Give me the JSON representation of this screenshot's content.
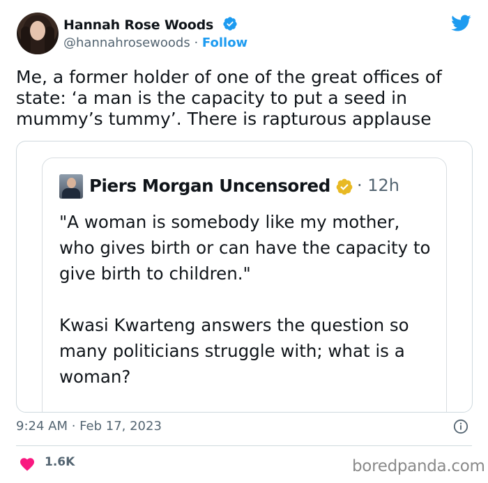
{
  "author": {
    "name": "Hannah Rose Woods",
    "handle": "@hannahrosewoods",
    "separator": "·",
    "follow_label": "Follow"
  },
  "tweet": {
    "text": "Me, a former holder of one of the great offices of state: ‘a man is the capacity to put a seed in mummy’s tummy’. There is rapturous applause"
  },
  "quoted": {
    "name": "Piers Morgan Uncensored",
    "time": "· 12h",
    "paragraph1": "\"A woman is somebody like my mother, who gives birth or can have the capacity to give birth to children.\"",
    "paragraph2": "Kwasi Kwarteng answers the question so many politicians struggle with; what is a woman?"
  },
  "footer": {
    "timestamp": "9:24 AM · Feb 17, 2023",
    "likes": "1.6K",
    "watermark": "boredpanda.com"
  },
  "colors": {
    "twitter_blue": "#1d9bf0",
    "heart_pink": "#f91880",
    "gold_badge": "#e8b923"
  },
  "icons": [
    "verified-badge-icon",
    "twitter-bird-icon",
    "gold-verified-badge-icon",
    "info-icon",
    "heart-icon"
  ]
}
